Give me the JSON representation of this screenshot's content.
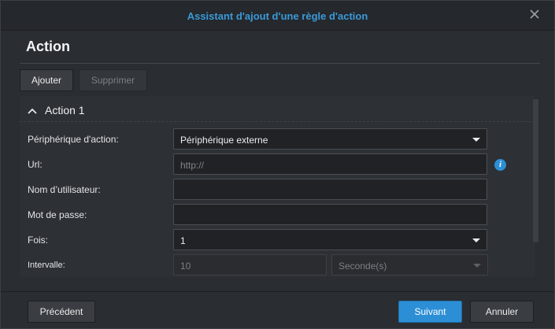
{
  "dialog": {
    "title": "Assistant d'ajout d'une règle d'action",
    "close_icon": "close-icon"
  },
  "section": {
    "title": "Action"
  },
  "toolbar": {
    "add_label": "Ajouter",
    "delete_label": "Supprimer"
  },
  "action_panel": {
    "title": "Action 1",
    "expand_icon": "chevron-up-icon",
    "fields": {
      "device": {
        "label": "Périphérique d'action:",
        "value": "Périphérique externe"
      },
      "url": {
        "label": "Url:",
        "placeholder": "http://",
        "value": ""
      },
      "username": {
        "label": "Nom d’utilisateur:",
        "value": ""
      },
      "password": {
        "label": "Mot de passe:",
        "value": ""
      },
      "times": {
        "label": "Fois:",
        "value": "1"
      },
      "interval": {
        "label": "Intervalle:",
        "value": "10",
        "unit": "Seconde(s)"
      }
    }
  },
  "footer": {
    "previous_label": "Précédent",
    "next_label": "Suivant",
    "cancel_label": "Annuler"
  },
  "colors": {
    "accent": "#2c8fd6",
    "title": "#3a9ad9",
    "background": "#2a2d31"
  }
}
